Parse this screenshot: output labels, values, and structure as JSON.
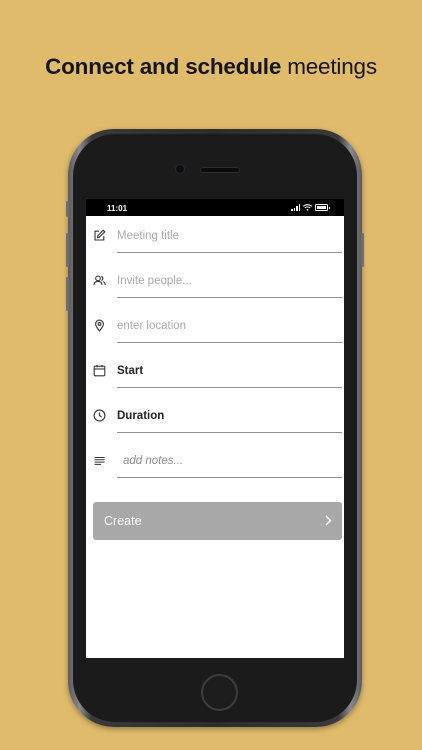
{
  "headline": {
    "bold": "Connect and schedule",
    "light": "meetings"
  },
  "statusbar": {
    "time": "11:01"
  },
  "form": {
    "title_placeholder": "Meeting title",
    "invite_placeholder": "Invite people...",
    "location_placeholder": "enter location",
    "start_label": "Start",
    "duration_label": "Duration",
    "notes_placeholder": "add notes..."
  },
  "create_button": {
    "label": "Create"
  },
  "icons": [
    "edit-icon",
    "people-icon",
    "location-pin-icon",
    "calendar-icon",
    "clock-icon",
    "notes-lines-icon",
    "chevron-right-icon"
  ],
  "colors": {
    "background": "#e0bb6c",
    "button": "#a8a8a8",
    "placeholder": "#a9a9a9"
  }
}
